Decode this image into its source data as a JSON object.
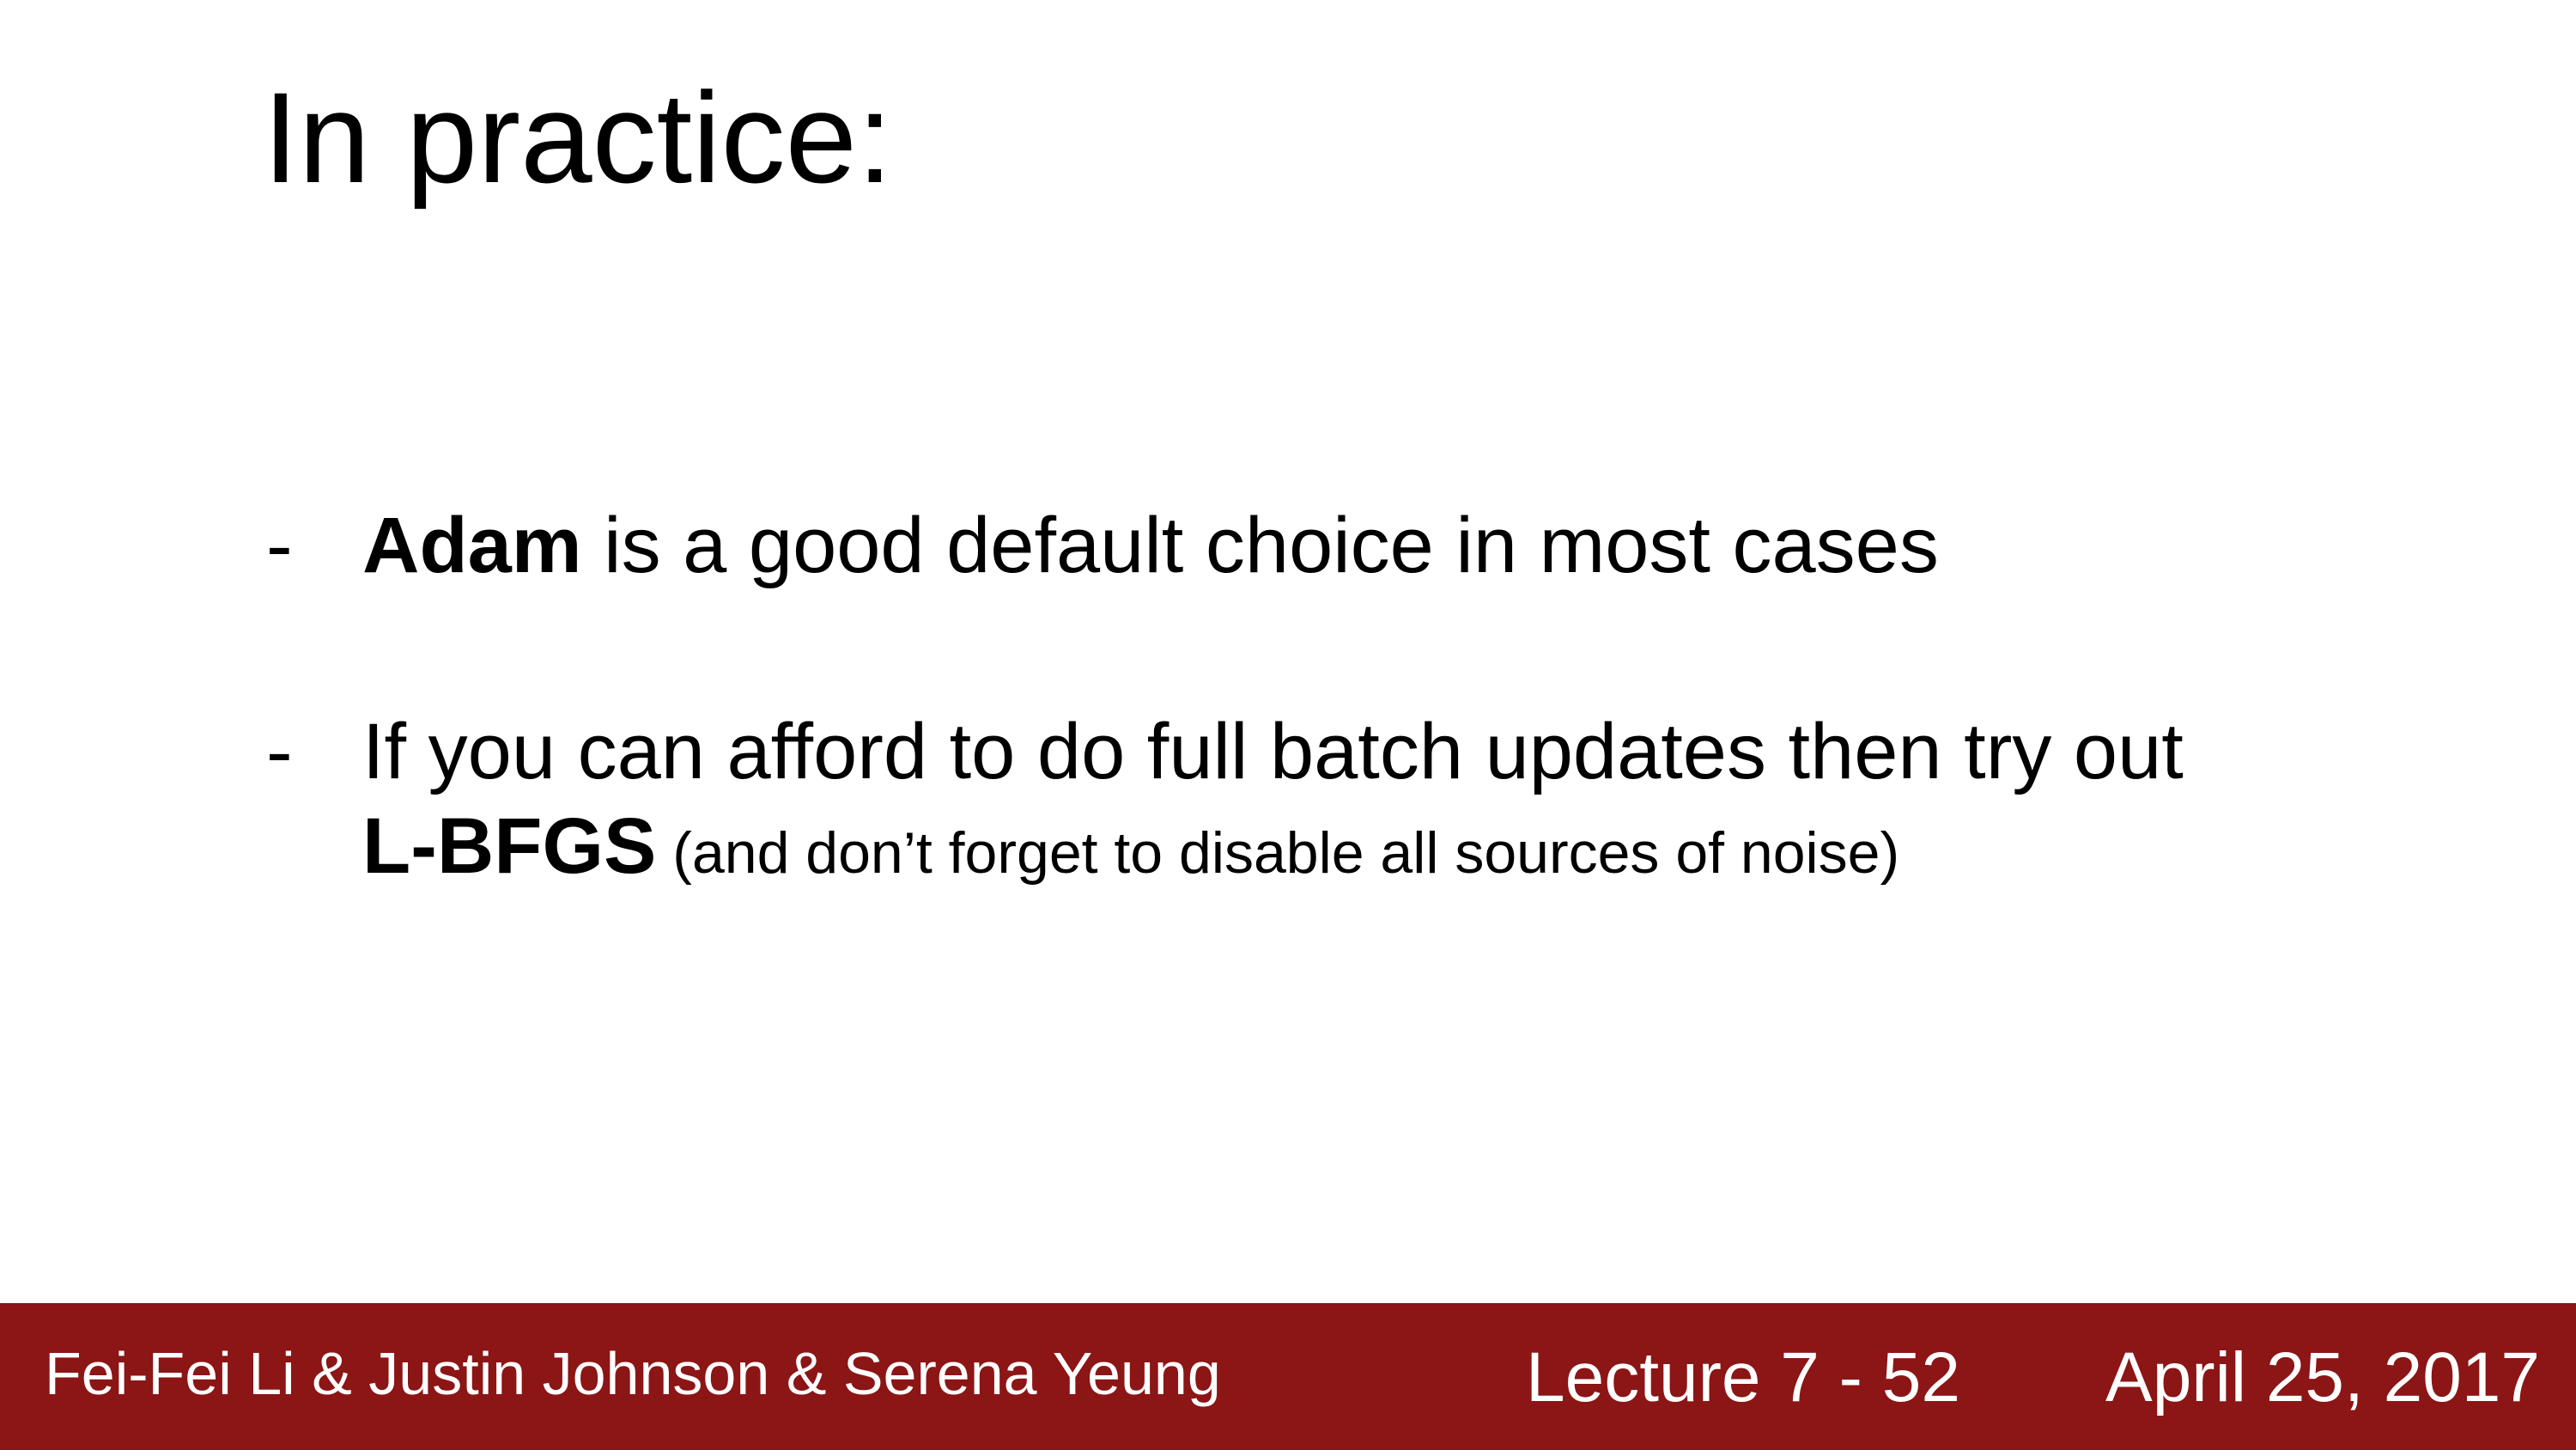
{
  "title": "In practice:",
  "bullets": [
    {
      "dash": "-",
      "bold": "Adam",
      "text": " is a good default choice in most cases"
    },
    {
      "dash": "-",
      "line1": "If you can afford to do full batch updates then try out",
      "bold": "L-BFGS",
      "note": " (and don’t forget to disable all sources of noise)"
    }
  ],
  "footer": {
    "authors": "Fei-Fei Li & Justin Johnson & Serena Yeung",
    "lecture": "Lecture 7 - 52",
    "date": "April 25, 2017",
    "background_color": "#8c1515",
    "text_color": "#ffffff"
  }
}
